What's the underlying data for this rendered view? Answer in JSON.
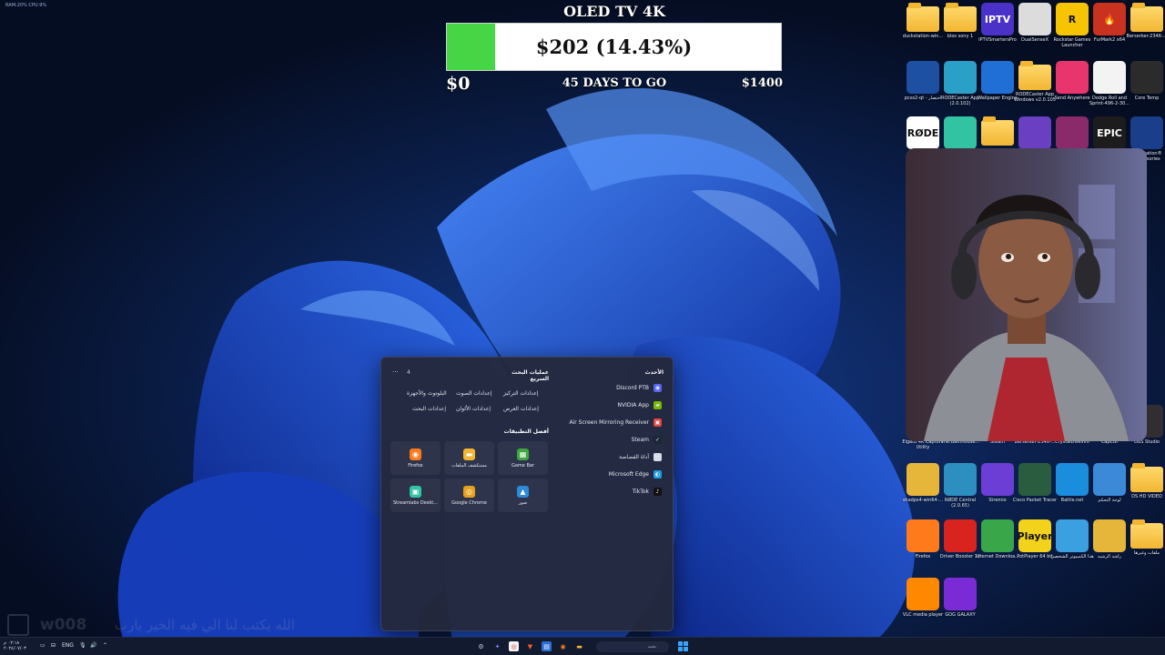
{
  "colors": {
    "wallpaper_bg": "#071126",
    "bloom_dark": "#0a2fb0",
    "bloom_light": "#3d7bff",
    "progress_green": "#45d545",
    "start_menu_bg": "#24283a",
    "taskbar_bg": "#111a2e"
  },
  "system_stats": "RAM:20%  CPU:9%",
  "goal": {
    "title": "OLED TV 4K",
    "amount": "$202 (14.43%)",
    "progress_fraction": 0.1443,
    "min": "$0",
    "days": "45 DAYS TO GO",
    "max": "$1400"
  },
  "desktop_icons": [
    {
      "label": "duckstation-win...",
      "icon": "folder-icon",
      "kind": "folder"
    },
    {
      "label": "blos sony 1",
      "icon": "folder-icon",
      "kind": "folder"
    },
    {
      "label": "IPTVSmartersPro",
      "icon": "iptv-icon",
      "kind": "app",
      "text": "IPTV",
      "color": "#4a32c8"
    },
    {
      "label": "DualSenseX",
      "icon": "controller-icon",
      "kind": "app",
      "text": "",
      "color": "#dcdcdc"
    },
    {
      "label": "Rockstar Games Launcher",
      "icon": "rockstar-icon",
      "kind": "app",
      "text": "R",
      "color": "#f6c400"
    },
    {
      "label": "FurMark2 x64",
      "icon": "furmark-icon",
      "kind": "app",
      "text": "🔥",
      "color": "#c8321e"
    },
    {
      "label": "Berserker-2346-...",
      "icon": "folder-icon",
      "kind": "folder"
    },
    {
      "label": "pcsx2-qt - اختصار",
      "icon": "pcsx2-icon",
      "kind": "app",
      "text": "",
      "color": "#1d4fa3"
    },
    {
      "label": "RODECaster App (2.0.102)",
      "icon": "rodecaster-icon",
      "kind": "app",
      "text": "",
      "color": "#2aa0c8"
    },
    {
      "label": "Wallpaper Engine",
      "icon": "wallpaper-engine-icon",
      "kind": "app",
      "text": "",
      "color": "#1f6fd6"
    },
    {
      "label": "RODECaster App Windows v2.0.105",
      "icon": "folder-icon",
      "kind": "folder"
    },
    {
      "label": "Send Anywhere",
      "icon": "send-anywhere-icon",
      "kind": "app",
      "text": "",
      "color": "#e8356d"
    },
    {
      "label": "Dodge Roll and Sprint-496-2-30...",
      "icon": "file-icon",
      "kind": "app",
      "text": "",
      "color": "#f3f3f3"
    },
    {
      "label": "Core Temp",
      "icon": "core-temp-icon",
      "kind": "app",
      "text": "",
      "color": "#2b2b2b"
    },
    {
      "label": "RØDE",
      "icon": "rode-icon",
      "kind": "app",
      "text": "RØDE",
      "color": "#ffffff"
    },
    {
      "label": "",
      "icon": "streamlabs-icon",
      "kind": "app",
      "text": "",
      "color": "#31c3a2"
    },
    {
      "label": "",
      "icon": "folder-icon",
      "kind": "folder"
    },
    {
      "label": "",
      "icon": "cpu-icon",
      "kind": "app",
      "text": "",
      "color": "#6a3fc2"
    },
    {
      "label": "",
      "icon": "winrar-icon",
      "kind": "app",
      "text": "",
      "color": "#8a2a6a"
    },
    {
      "label": "Epic Games Launcher",
      "icon": "epic-games-icon",
      "kind": "app",
      "text": "EPIC",
      "color": "#1c1c1c"
    },
    {
      "label": "PlayStation® Accessories",
      "icon": "playstation-icon",
      "kind": "app",
      "text": "",
      "color": "#1a3e8a"
    },
    {
      "label": "Elgato 4K Capture Utility",
      "icon": "elgato-icon",
      "kind": "app",
      "text": "",
      "color": "#1a1a1a"
    },
    {
      "label": "The.Bathhouse...",
      "icon": "file-icon",
      "kind": "app",
      "text": "",
      "color": "#444"
    },
    {
      "label": "Steam",
      "icon": "steam-icon",
      "kind": "app",
      "text": "",
      "color": "#1b2838"
    },
    {
      "label": "Berserker-2346-...",
      "icon": "file-icon",
      "kind": "app",
      "text": "",
      "color": "#444"
    },
    {
      "label": "CrystalDiskInfo",
      "icon": "crystaldiskinfo-icon",
      "kind": "app",
      "text": "",
      "color": "#3a7fd0"
    },
    {
      "label": "CapCut",
      "icon": "capcut-icon",
      "kind": "app",
      "text": "",
      "color": "#ffffff"
    },
    {
      "label": "OBS Studio",
      "icon": "obs-icon",
      "kind": "app",
      "text": "",
      "color": "#302e31"
    },
    {
      "label": "shadps4-win64-...",
      "icon": "shadps4-icon",
      "kind": "app",
      "text": "",
      "color": "#e6b63a"
    },
    {
      "label": "RØDE Central (2.0.65)",
      "icon": "rode-central-icon",
      "kind": "app",
      "text": "",
      "color": "#2d8fbf"
    },
    {
      "label": "Stremio",
      "icon": "stremio-icon",
      "kind": "app",
      "text": "",
      "color": "#6b3fd6"
    },
    {
      "label": "Cisco Packet Tracer",
      "icon": "packet-tracer-icon",
      "kind": "app",
      "text": "",
      "color": "#2a5d3f"
    },
    {
      "label": "Battle.net",
      "icon": "battlenet-icon",
      "kind": "app",
      "text": "",
      "color": "#1b8ddd"
    },
    {
      "label": "لوحة التحكم",
      "icon": "control-panel-icon",
      "kind": "app",
      "text": "",
      "color": "#3b8ad8"
    },
    {
      "label": "DS HD VIDEO",
      "icon": "folder-icon",
      "kind": "folder"
    },
    {
      "label": "Firefox",
      "icon": "firefox-icon",
      "kind": "app",
      "text": "",
      "color": "#ff7a1a"
    },
    {
      "label": "Driver Booster 12",
      "icon": "driver-booster-icon",
      "kind": "app",
      "text": "",
      "color": "#d8231e"
    },
    {
      "label": "Internet Downloa...",
      "icon": "idm-icon",
      "kind": "app",
      "text": "",
      "color": "#3aa64a"
    },
    {
      "label": "PotPlayer 64 bit",
      "icon": "potplayer-icon",
      "kind": "app",
      "text": "Player",
      "color": "#f2d21a"
    },
    {
      "label": "هذا الكمبيوتر الشخصي",
      "icon": "this-pc-icon",
      "kind": "app",
      "text": "",
      "color": "#3aa0e0"
    },
    {
      "label": "راشد الرشيد",
      "icon": "user-folder-icon",
      "kind": "app",
      "text": "",
      "color": "#e6b63a"
    },
    {
      "label": "ملفات وغيرها",
      "icon": "folder-icon",
      "kind": "folder"
    },
    {
      "label": "VLC media player",
      "icon": "vlc-icon",
      "kind": "app",
      "text": "",
      "color": "#ff8800"
    },
    {
      "label": "GOG GALAXY",
      "icon": "gog-galaxy-icon",
      "kind": "app",
      "text": "",
      "color": "#7a2bd6"
    }
  ],
  "start_menu": {
    "recent_header": "الأحدث",
    "recent_items": [
      {
        "label": "Discord PTB",
        "icon": "discord-icon",
        "color": "#5865f2",
        "glyph": "◉"
      },
      {
        "label": "NVIDIA App",
        "icon": "nvidia-icon",
        "color": "#76b900",
        "glyph": "▰"
      },
      {
        "label": "Air Screen Mirroring Receiver",
        "icon": "mirroring-icon",
        "color": "#e0463c",
        "glyph": "▣"
      },
      {
        "label": "Steam",
        "icon": "steam-icon",
        "color": "#1b2838",
        "glyph": "✓"
      },
      {
        "label": "أداة القصاصة",
        "icon": "snipping-tool-icon",
        "color": "#d8dbe8",
        "glyph": "✂"
      },
      {
        "label": "Microsoft Edge",
        "icon": "edge-icon",
        "color": "#1b9de2",
        "glyph": "◐"
      },
      {
        "label": "TikTok",
        "icon": "tiktok-icon",
        "color": "#111111",
        "glyph": "♪"
      }
    ],
    "quick_search_header": "عمليات البحث السريع",
    "more_label": "···",
    "quick_search_count": "4",
    "quick_searches": [
      "إعدادات التركيز",
      "إعدادات الصوت",
      "البلوتوث والأجهزة",
      "إعدادات العرض",
      "إعدادات الألوان",
      "إعدادات البحث"
    ],
    "top_apps_header": "أفضل التطبيقات",
    "top_apps": [
      {
        "label": "Firefox",
        "icon": "firefox-icon",
        "color": "#ff7a1a",
        "glyph": "◉"
      },
      {
        "label": "مستكشف الملفات",
        "icon": "file-explorer-icon",
        "color": "#f2b632",
        "glyph": "▬"
      },
      {
        "label": "Game Bar",
        "icon": "game-bar-icon",
        "color": "#3ea83e",
        "glyph": "▦"
      },
      {
        "label": "Streamlabs Deskt...",
        "icon": "streamlabs-icon",
        "color": "#31c3a2",
        "glyph": "▣"
      },
      {
        "label": "Google Chrome",
        "icon": "chrome-icon",
        "color": "#e8a21a",
        "glyph": "◎"
      },
      {
        "label": "صور",
        "icon": "photos-icon",
        "color": "#2d8ad8",
        "glyph": "▲"
      }
    ]
  },
  "overlay": {
    "channel_name": "w008",
    "dua_text": "الله يكتب لنا الي فيه الخير يارب"
  },
  "taskbar": {
    "time": "٠٢:١٨ م",
    "date": "٢٠٢٤/٠٧/٠٣",
    "language": "ENG",
    "search_placeholder": "بحث"
  }
}
